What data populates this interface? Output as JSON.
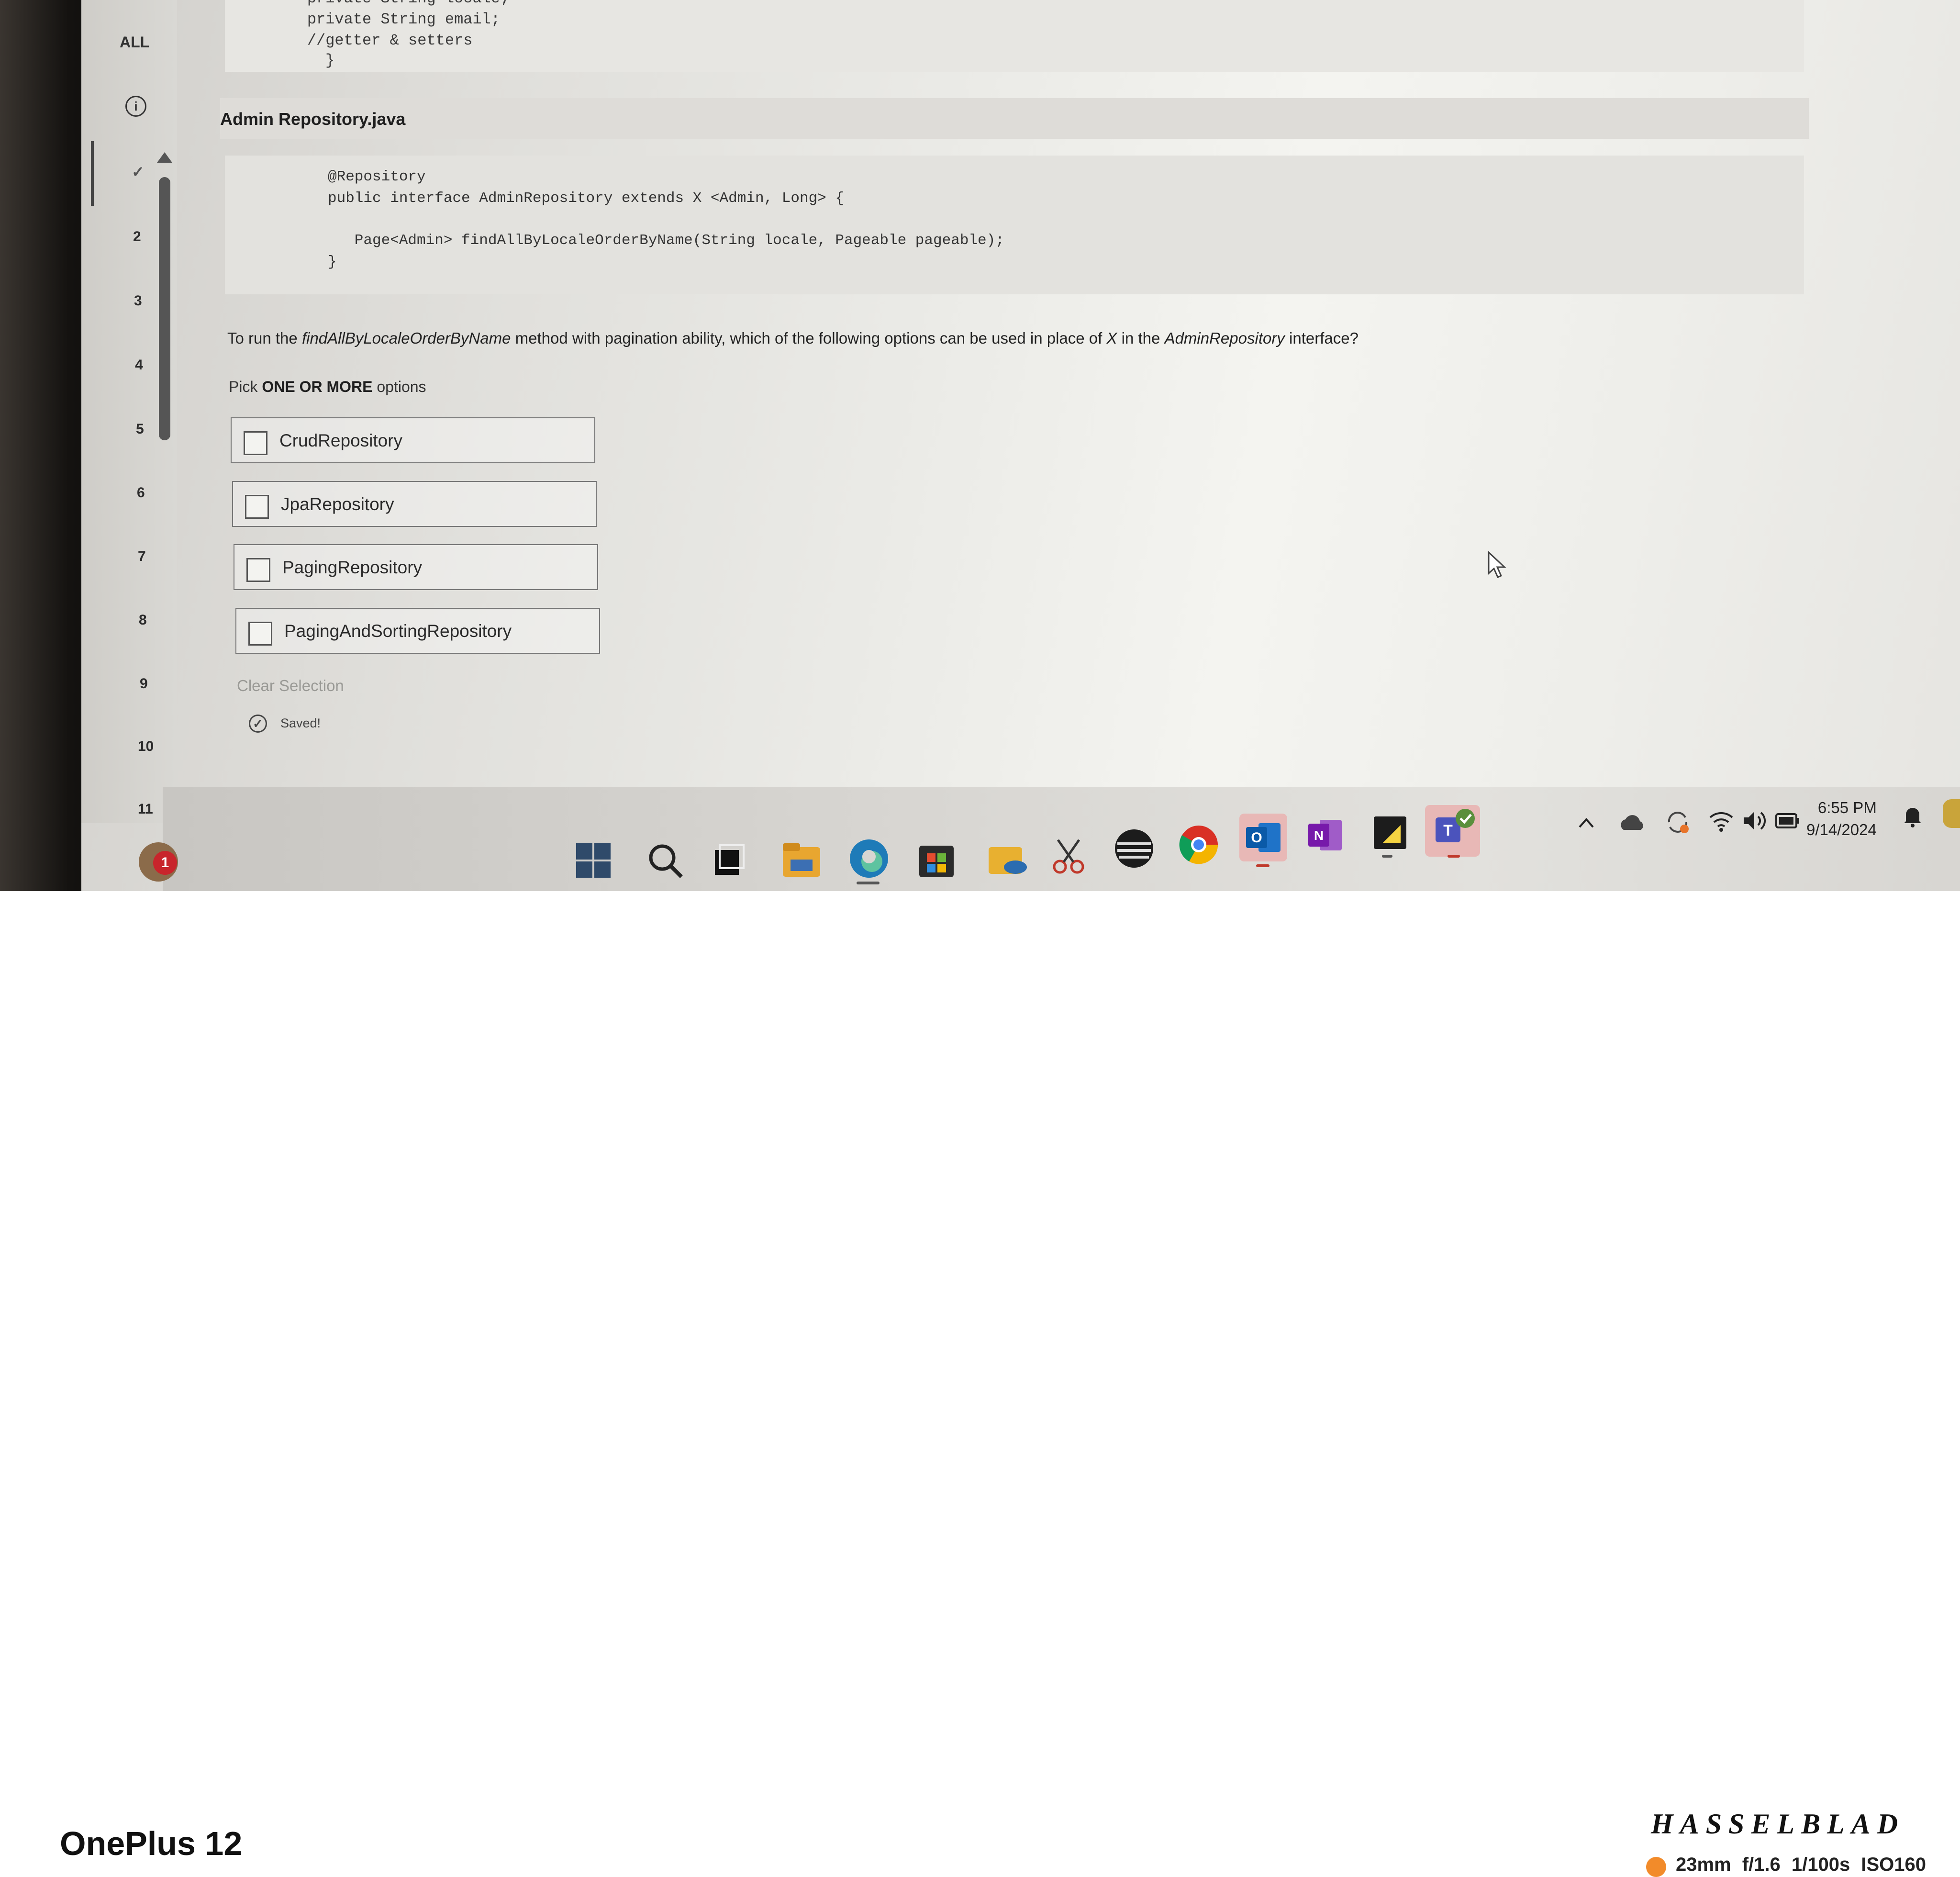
{
  "code_top": {
    "lines": [
      "    private String locale;",
      "    private String email;",
      "    //getter & setters",
      "}"
    ]
  },
  "file": {
    "title": "Admin Repository.java"
  },
  "code_main": {
    "lines": [
      "@Repository",
      "public interface AdminRepository extends X <Admin, Long> {",
      "",
      "   Page<Admin> findAllByLocaleOrderByName(String locale, Pageable pageable);",
      "}"
    ]
  },
  "question": {
    "prefix": "To run the ",
    "method": "findAllByLocaleOrderByName",
    "middle": " method with pagination ability, which of the following options can be used in place of ",
    "x": "X",
    "middle2": " in the ",
    "iface": "AdminRepository",
    "suffix": " interface?"
  },
  "pick": {
    "prefix": "Pick ",
    "bold": "ONE OR MORE",
    "suffix": " options"
  },
  "options": [
    "CrudRepository",
    "JpaRepository",
    "PagingRepository",
    "PagingAndSortingRepository"
  ],
  "clear_selection": "Clear Selection",
  "saved": "Saved!",
  "nav": {
    "all": "ALL",
    "info": "i",
    "check": "✓",
    "items": [
      "2",
      "3",
      "4",
      "5",
      "6",
      "7",
      "8",
      "9",
      "10",
      "11"
    ]
  },
  "taskbar": {
    "notification_count": "1",
    "clock_time": "6:55 PM",
    "clock_date": "9/14/2024"
  },
  "footer": {
    "device": "OnePlus 12",
    "brand": "HASSELBLAD",
    "specs": "23mm  f/1.6  1/100s  ISO160"
  }
}
